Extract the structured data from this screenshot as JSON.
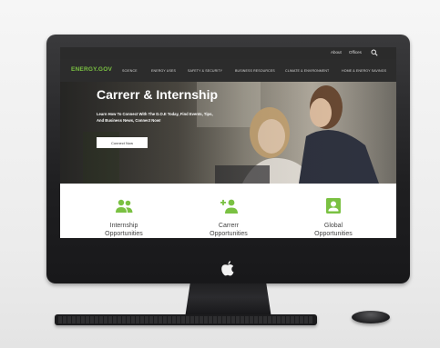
{
  "site": {
    "logo": "ENERGY.GOV",
    "top_links": [
      "About",
      "Offices"
    ],
    "nav": [
      "SCIENCE",
      "ENERGY USES",
      "SAFETY & SECURITY",
      "BUSINESS RESOURCES",
      "CLIMATE & ENVIRONMENT",
      "HOME & ENERGY SAVINGS"
    ],
    "hero": {
      "title": "Carrerr & Internship",
      "subtitle_line1": "Learn How To Connect With The D.O.E Today, Find Events, Tips,",
      "subtitle_line2": "And Business News, Connect Now!",
      "cta": "Connect Now"
    },
    "features": [
      {
        "label_line1": "Internship",
        "label_line2": "Opportunities",
        "icon": "people-icon"
      },
      {
        "label_line1": "Carrerr",
        "label_line2": "Opportunities",
        "icon": "add-user-icon"
      },
      {
        "label_line1": "Global",
        "label_line2": "Opportunities",
        "icon": "user-card-icon"
      }
    ]
  },
  "colors": {
    "accent": "#7ac142",
    "nav_bg": "#2c2c2c",
    "monitor": "#1f1f21"
  }
}
